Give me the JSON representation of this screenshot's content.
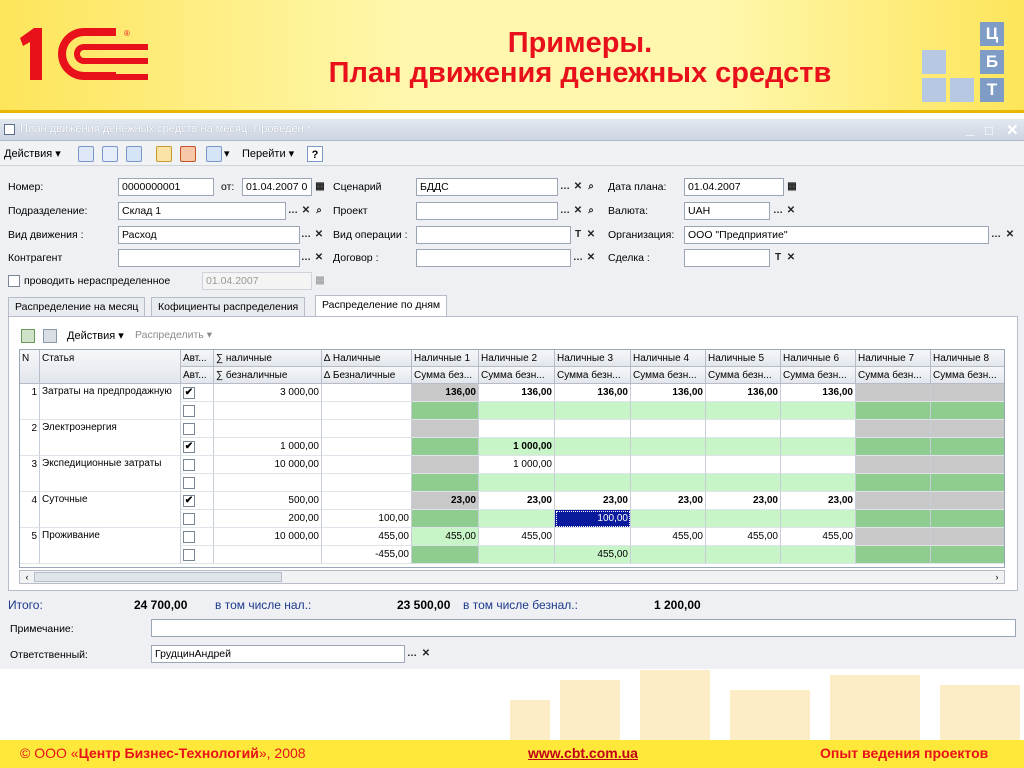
{
  "slide": {
    "title_line1": "Примеры.",
    "title_line2": "План движения денежных средств",
    "cbt_letters": [
      "Ц",
      "Б",
      "Т"
    ]
  },
  "window": {
    "title": "План движения денежных средств на месяц: Проведен *",
    "controls": [
      "_",
      "□",
      "✕"
    ]
  },
  "toolbar": {
    "actions": "Действия",
    "goto": "Перейти",
    "help": "?"
  },
  "form": {
    "number_label": "Номер:",
    "number_value": "0000000001",
    "from_label": "от:",
    "from_value": "01.04.2007  0",
    "division_label": "Подразделение:",
    "division_value": "Склад 1",
    "movement_label": "Вид движения :",
    "movement_value": "Расход",
    "counterparty_label": "Контрагент",
    "counterparty_value": "",
    "unallocated_label": "проводить нераспределенное",
    "unallocated_date": "01.04.2007",
    "scenario_label": "Сценарий",
    "scenario_value": "БДДС",
    "project_label": "Проект",
    "project_value": "",
    "operation_label": "Вид операции :",
    "operation_value": "",
    "contract_label": "Договор :",
    "contract_value": "",
    "plan_date_label": "Дата плана:",
    "plan_date_value": "01.04.2007",
    "currency_label": "Валюта:",
    "currency_value": "UAH",
    "org_label": "Организация:",
    "org_value": "ООО \"Предприятие\"",
    "deal_label": "Сделка :",
    "deal_value": ""
  },
  "tabs": [
    "Распределение на месяц",
    "Кофициенты распределения",
    "Распределение по дням"
  ],
  "panel_toolbar": {
    "actions": "Действия",
    "distribute": "Распределить"
  },
  "grid": {
    "header_row1": [
      "N",
      "Статья",
      "Авт...",
      "∑ наличные",
      "∆ Наличные",
      "Наличные 1",
      "Наличные 2",
      "Наличные 3",
      "Наличные 4",
      "Наличные 5",
      "Наличные 6",
      "Наличные 7",
      "Наличные 8"
    ],
    "header_row2": [
      "",
      "",
      "Авт...",
      "∑ безналичные",
      "∆ Безналичные",
      "Сумма без...",
      "Сумма безн...",
      "Сумма безн...",
      "Сумма безн...",
      "Сумма безн...",
      "Сумма безн...",
      "Сумма безн...",
      "Сумма безн..."
    ],
    "rows": [
      {
        "n": "1",
        "article": "Затраты на предпродажную",
        "auto1": true,
        "auto2": false,
        "cash": "3 000,00",
        "noncash": "",
        "dcash": "",
        "dnoncash": "",
        "days_cash": [
          "136,00",
          "136,00",
          "136,00",
          "136,00",
          "136,00",
          "136,00",
          "",
          ""
        ],
        "days_noncash": [
          "",
          "",
          "",
          "",
          "",
          "",
          "",
          ""
        ]
      },
      {
        "n": "2",
        "article": "Электроэнергия",
        "auto1": false,
        "auto2": true,
        "cash": "",
        "noncash": "1 000,00",
        "dcash": "",
        "dnoncash": "",
        "days_cash": [
          "",
          "",
          "",
          "",
          "",
          "",
          "",
          ""
        ],
        "days_noncash": [
          "",
          "1 000,00",
          "",
          "",
          "",
          "",
          "",
          ""
        ]
      },
      {
        "n": "3",
        "article": "Экспедиционные затраты",
        "auto1": false,
        "auto2": false,
        "cash": "10 000,00",
        "noncash": "",
        "dcash": "",
        "dnoncash": "",
        "days_cash": [
          "",
          "1 000,00",
          "",
          "",
          "",
          "",
          "",
          ""
        ],
        "days_noncash": [
          "",
          "",
          "",
          "",
          "",
          "",
          "",
          ""
        ]
      },
      {
        "n": "4",
        "article": "Суточные",
        "auto1": true,
        "auto2": false,
        "cash": "500,00",
        "noncash": "200,00",
        "dcash": "",
        "dnoncash": "100,00",
        "days_cash": [
          "23,00",
          "23,00",
          "23,00",
          "23,00",
          "23,00",
          "23,00",
          "",
          ""
        ],
        "days_noncash": [
          "",
          "",
          "100,00",
          "",
          "",
          "",
          "",
          ""
        ]
      },
      {
        "n": "5",
        "article": "Проживание",
        "auto1": false,
        "auto2": false,
        "cash": "10 000,00",
        "noncash": "",
        "dcash": "455,00",
        "dnoncash": "-455,00",
        "days_cash": [
          "455,00",
          "455,00",
          "",
          "455,00",
          "455,00",
          "455,00",
          "",
          ""
        ],
        "days_noncash": [
          "",
          "",
          "455,00",
          "",
          "",
          "",
          "",
          ""
        ]
      }
    ]
  },
  "totals": {
    "label": "Итого:",
    "total": "24 700,00",
    "cash_label": "в том числе нал.:",
    "cash": "23 500,00",
    "noncash_label": "в том числе безнал.:",
    "noncash": "1 200,00"
  },
  "note": {
    "label": "Примечание:",
    "value": ""
  },
  "responsible": {
    "label": "Ответственный:",
    "value": "ГрудцинАндрей"
  },
  "footer": {
    "copyright_pre": "© ООО «",
    "company": "Центр Бизнес-Технологий",
    "copyright_post": "», 2008",
    "site": "www.cbt.com.ua",
    "motto": "Опыт ведения проектов"
  },
  "colors": {
    "brand_red": "#e8101a",
    "header_yellow": "#fde55a",
    "cell_green_dark": "#8fcc8f",
    "cell_green_light": "#c8f5c8",
    "cell_gray": "#c8c8c8"
  }
}
